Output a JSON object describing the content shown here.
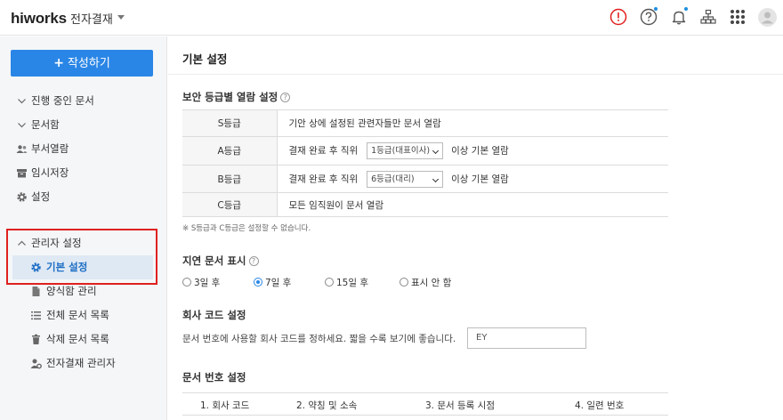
{
  "header": {
    "logo": "hiworks",
    "app_title": "전자결재",
    "icons": [
      "alert-icon",
      "help-icon",
      "bell-icon",
      "org-chart-icon",
      "apps-grid-icon",
      "avatar"
    ]
  },
  "sidebar": {
    "compose_label": "작성하기",
    "items": [
      {
        "label": "진행 중인 문서",
        "icon": "chevron-down-icon"
      },
      {
        "label": "문서함",
        "icon": "chevron-down-icon"
      },
      {
        "label": "부서열람",
        "icon": "users-icon"
      },
      {
        "label": "임시저장",
        "icon": "box-icon"
      },
      {
        "label": "설정",
        "icon": "gear-icon"
      }
    ],
    "admin": {
      "label": "관리자 설정",
      "items": [
        {
          "label": "기본 설정",
          "icon": "gear-icon",
          "active": true
        },
        {
          "label": "양식함 관리",
          "icon": "file-icon"
        },
        {
          "label": "전체 문서 목록",
          "icon": "list-icon"
        },
        {
          "label": "삭제 문서 목록",
          "icon": "trash-icon"
        },
        {
          "label": "전자결재 관리자",
          "icon": "user-gear-icon"
        }
      ]
    }
  },
  "main": {
    "page_title": "기본 설정",
    "security": {
      "title": "보안 등급별 열람 설정",
      "rows": [
        {
          "grade": "S등급",
          "text": "기안 상에 설정된 관련자들만 문서 열람"
        },
        {
          "grade": "A등급",
          "prefix": "결재 완료 후 직위",
          "select": "1등급(대표이사)",
          "suffix": "이상 기본 열람"
        },
        {
          "grade": "B등급",
          "prefix": "결재 완료 후 직위",
          "select": "6등급(대리)",
          "suffix": "이상 기본 열람"
        },
        {
          "grade": "C등급",
          "text": "모든 임직원이 문서 열람"
        }
      ],
      "note": "※ S등급과 C등급은 설정할 수 없습니다."
    },
    "delay": {
      "title": "지연 문서 표시",
      "options": [
        "3일 후",
        "7일 후",
        "15일 후",
        "표시 안 함"
      ],
      "selected": "7일 후"
    },
    "company_code": {
      "title": "회사 코드 설정",
      "description": "문서 번호에 사용할 회사 코드를 정하세요. 짧을 수록 보기에 좋습니다.",
      "value": "EY"
    },
    "doc_number": {
      "title": "문서 번호 설정",
      "columns": [
        "1. 회사 코드",
        "2. 약칭 및 소속",
        "3. 문서 등록 시점",
        "4. 일련 번호"
      ]
    },
    "colors": {
      "accent": "#2a86e6",
      "active_bg": "#dfe9f4",
      "highlight": "#e02020",
      "alert": "#e02020"
    }
  }
}
